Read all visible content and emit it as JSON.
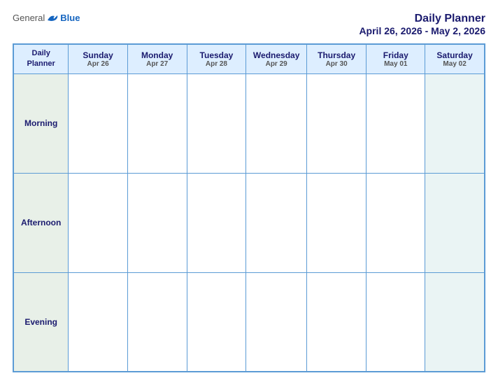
{
  "header": {
    "logo_general": "General",
    "logo_blue": "Blue",
    "title_main": "Daily Planner",
    "title_sub": "April 26, 2026 - May 2, 2026"
  },
  "columns": [
    {
      "day": "Daily",
      "day2": "Planner",
      "date": ""
    },
    {
      "day": "Sunday",
      "date": "Apr 26"
    },
    {
      "day": "Monday",
      "date": "Apr 27"
    },
    {
      "day": "Tuesday",
      "date": "Apr 28"
    },
    {
      "day": "Wednesday",
      "date": "Apr 29"
    },
    {
      "day": "Thursday",
      "date": "Apr 30"
    },
    {
      "day": "Friday",
      "date": "May 01"
    },
    {
      "day": "Saturday",
      "date": "May 02"
    }
  ],
  "rows": [
    {
      "label": "Morning"
    },
    {
      "label": "Afternoon"
    },
    {
      "label": "Evening"
    }
  ]
}
